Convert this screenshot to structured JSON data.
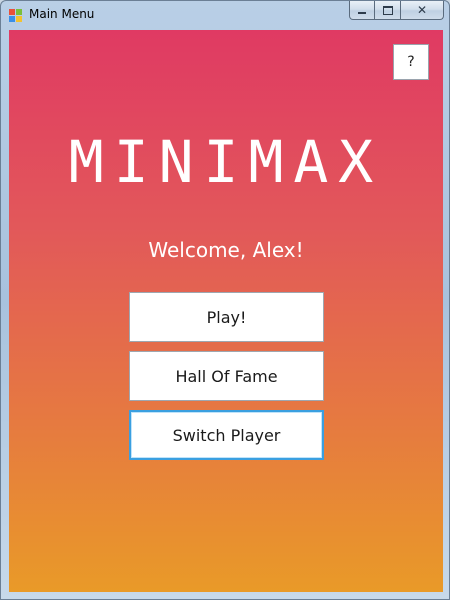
{
  "window": {
    "title": "Main Menu",
    "icon": "windows-form-icon",
    "controls": [
      "minimize-icon",
      "maximize-icon",
      "close-icon"
    ],
    "close_glyph": "✕"
  },
  "main": {
    "help_label": "?",
    "app_title": "MINIMAX",
    "welcome_text": "Welcome, Alex!",
    "buttons": {
      "play": "Play!",
      "hall_of_fame": "Hall Of Fame",
      "switch_player": "Switch Player"
    },
    "focused_button": "switch_player"
  },
  "colors": {
    "gradient_top": "#e03a63",
    "gradient_bottom": "#e99a28",
    "focus_border": "#3a9fe0"
  }
}
